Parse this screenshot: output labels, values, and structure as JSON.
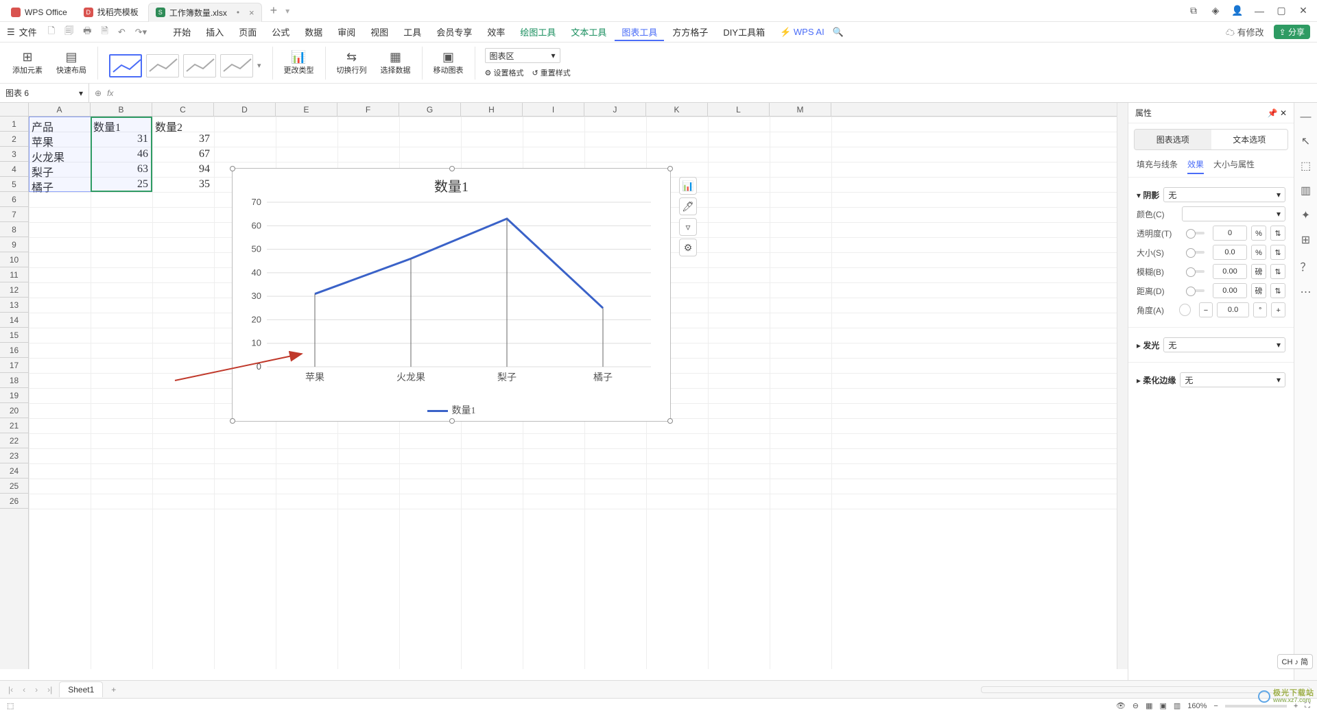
{
  "titlebar": {
    "tabs": [
      {
        "icon": "red-w",
        "label": "WPS Office"
      },
      {
        "icon": "red-d",
        "label": "找稻壳模板"
      },
      {
        "icon": "green-s",
        "label": "工作簿数量.xlsx",
        "dirty": "•",
        "close": "×"
      }
    ],
    "new": "+"
  },
  "menubar": {
    "file": "文件",
    "tabs": [
      "开始",
      "插入",
      "页面",
      "公式",
      "数据",
      "审阅",
      "视图",
      "工具",
      "会员专享",
      "效率"
    ],
    "green_tabs": [
      "绘图工具",
      "文本工具"
    ],
    "active": "图表工具",
    "after": [
      "方方格子",
      "DIY工具箱"
    ],
    "wps_ai": "WPS AI",
    "has_mod": "有修改",
    "share": "分享"
  },
  "ribbon": {
    "add_element": "添加元素",
    "quick_layout": "快速布局",
    "change_type": "更改类型",
    "switch_rowcol": "切换行列",
    "select_data": "选择数据",
    "move_chart": "移动图表",
    "chartarea": "图表区",
    "set_format": "设置格式",
    "reset_style": "重置样式"
  },
  "formula": {
    "namebox": "图表 6",
    "fx": "fx"
  },
  "columns": [
    "A",
    "B",
    "C",
    "D",
    "E",
    "F",
    "G",
    "H",
    "I",
    "J",
    "K",
    "L",
    "M"
  ],
  "rows": 26,
  "table": {
    "headers": [
      "产品",
      "数量1",
      "数量2"
    ],
    "rows": [
      [
        "苹果",
        "31",
        "37"
      ],
      [
        "火龙果",
        "46",
        "67"
      ],
      [
        "梨子",
        "63",
        "94"
      ],
      [
        "橘子",
        "25",
        "35"
      ]
    ]
  },
  "chart_data": {
    "type": "line",
    "title": "数量1",
    "categories": [
      "苹果",
      "火龙果",
      "梨子",
      "橘子"
    ],
    "series": [
      {
        "name": "数量1",
        "values": [
          31,
          46,
          63,
          25
        ]
      }
    ],
    "ylim": [
      0,
      70
    ],
    "yticks": [
      0,
      10,
      20,
      30,
      40,
      50,
      60,
      70
    ],
    "legend": "数量1"
  },
  "right_panel": {
    "title": "属性",
    "tab1": "图表选项",
    "tab2": "文本选项",
    "sub": [
      "填充与线条",
      "效果",
      "大小与属性"
    ],
    "sub_active": "效果",
    "section_shadow": "阴影",
    "none": "无",
    "labels": {
      "color": "颜色(C)",
      "trans": "透明度(T)",
      "size": "大小(S)",
      "blur": "模糊(B)",
      "dist": "距离(D)",
      "angle": "角度(A)"
    },
    "vals": {
      "trans": "0",
      "trans_u": "%",
      "size": "0.0",
      "size_u": "%",
      "blur": "0.00",
      "blur_u": "磅",
      "dist": "0.00",
      "dist_u": "磅",
      "angle": "0.0",
      "angle_u": "°"
    },
    "section_glow": "发光",
    "section_soft": "柔化边缘"
  },
  "sheets": {
    "sheet1": "Sheet1",
    "add": "+"
  },
  "status": {
    "zoom": "160%",
    "ime": "CH ♪ 简"
  },
  "watermark": {
    "text": "极光下载站",
    "url": "www.xz7.com"
  }
}
